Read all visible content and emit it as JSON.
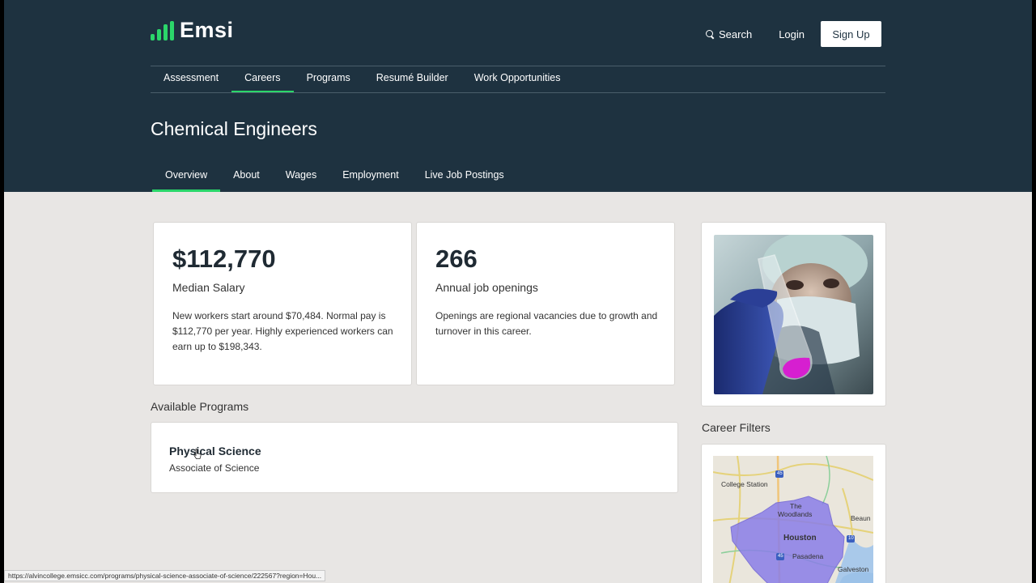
{
  "brand": {
    "name": "Emsi",
    "accent_color": "#2bd66a",
    "header_bg": "#1e3240"
  },
  "top_actions": {
    "search_label": "Search",
    "login_label": "Login",
    "signup_label": "Sign Up"
  },
  "main_nav": [
    {
      "label": "Assessment",
      "active": false
    },
    {
      "label": "Careers",
      "active": true
    },
    {
      "label": "Programs",
      "active": false
    },
    {
      "label": "Resumé Builder",
      "active": false
    },
    {
      "label": "Work Opportunities",
      "active": false
    }
  ],
  "page_title": "Chemical Engineers",
  "sub_nav": [
    {
      "label": "Overview",
      "active": true
    },
    {
      "label": "About",
      "active": false
    },
    {
      "label": "Wages",
      "active": false
    },
    {
      "label": "Employment",
      "active": false
    },
    {
      "label": "Live Job Postings",
      "active": false
    }
  ],
  "salary_card": {
    "value": "$112,770",
    "label": "Median Salary",
    "description": "New workers start around $70,484. Normal pay is $112,770 per year. Highly experienced workers can earn up to $198,343."
  },
  "openings_card": {
    "value": "266",
    "label": "Annual job openings",
    "description": "Openings are regional vacancies due to growth and turnover in this career."
  },
  "available_programs": {
    "heading": "Available Programs",
    "items": [
      {
        "title": "Physical Science",
        "degree": "Associate of Science"
      }
    ]
  },
  "career_filters": {
    "heading": "Career Filters",
    "map_labels": {
      "college_station": "College Station",
      "the": "The",
      "woodlands": "Woodlands",
      "houston": "Houston",
      "pasadena": "Pasadena",
      "galveston": "Galveston",
      "beaumont": "Beaun",
      "i45": "45",
      "i10": "10",
      "i45s": "45"
    }
  },
  "status_url": "https://alvincollege.emsicc.com/programs/physical-science-associate-of-science/222567?region=Hou..."
}
